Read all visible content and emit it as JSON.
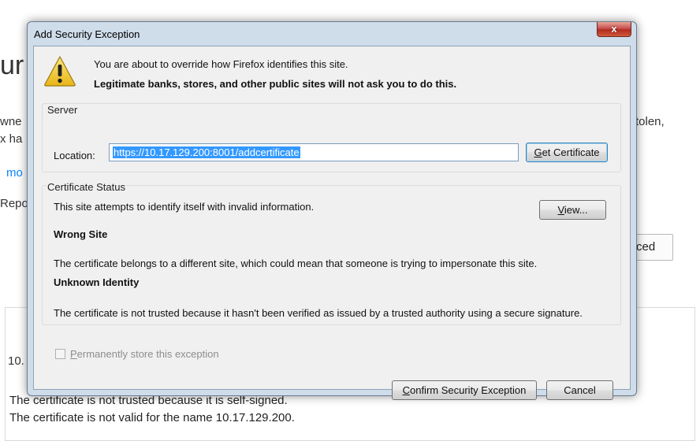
{
  "background_page": {
    "title_fragment": "ur",
    "left_fragments": [
      "wne",
      "x ha",
      "mo",
      "Repo"
    ],
    "right_fragments": [
      "tolen,"
    ],
    "advanced_fragment": "ced",
    "host_fragment": "10.",
    "cert_line_1": "The certificate is not trusted because it is self-signed.",
    "cert_line_2": "The certificate is not valid for the name 10.17.129.200."
  },
  "dialog": {
    "title": "Add Security Exception",
    "close_label": "x",
    "intro_line_1": "You are about to override how Firefox identifies this site.",
    "intro_line_2": "Legitimate banks, stores, and other public sites will not ask you to do this.",
    "server": {
      "group_label": "Server",
      "location_label": "Location:",
      "location_value": "https://10.17.129.200:8001/addcertificate",
      "get_certificate_label": "Get Certificate",
      "get_certificate_access_key": "G"
    },
    "status": {
      "group_label": "Certificate Status",
      "summary": "This site attempts to identify itself with invalid information.",
      "view_label": "View...",
      "view_access_key": "V",
      "issues": [
        {
          "heading": "Wrong Site",
          "detail": "The certificate belongs to a different site, which could mean that someone is trying to impersonate this site."
        },
        {
          "heading": "Unknown Identity",
          "detail": "The certificate is not trusted because it hasn't been verified as issued by a trusted authority using a secure signature."
        }
      ]
    },
    "permanent": {
      "label": "Permanently store this exception",
      "access_key": "P",
      "checked": false,
      "enabled": false
    },
    "confirm_label": "Confirm Security Exception",
    "confirm_access_key": "C",
    "cancel_label": "Cancel"
  },
  "icons": {
    "warning": "warning-triangle-icon",
    "close": "close-icon"
  },
  "colors": {
    "selection": "#3399ff",
    "window_frame": "#cfdcea",
    "close_button": "#c75050",
    "warning_yellow": "#f5cf2b",
    "disabled_text": "#8d8d8d",
    "link": "#0a84ff"
  }
}
